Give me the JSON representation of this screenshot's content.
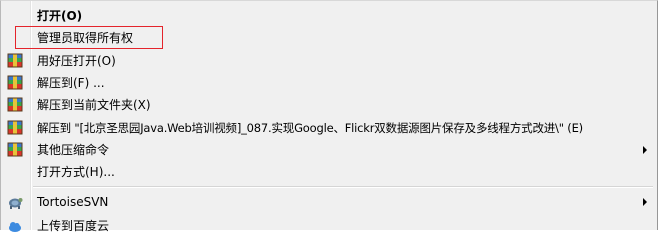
{
  "context_menu": {
    "items": [
      {
        "label": "打开(O)",
        "bold": true,
        "icon": "",
        "submenu": false
      },
      {
        "label": "管理员取得所有权",
        "bold": false,
        "icon": "",
        "submenu": false
      },
      {
        "label": "用好压打开(O)",
        "bold": false,
        "icon": "haozip-archive-icon",
        "submenu": false
      },
      {
        "label": "解压到(F) ...",
        "bold": false,
        "icon": "haozip-archive-icon",
        "submenu": false
      },
      {
        "label": "解压到当前文件夹(X)",
        "bold": false,
        "icon": "haozip-archive-icon",
        "submenu": false
      },
      {
        "label": "解压到 \"[北京圣思园Java.Web培训视频]_087.实现Google、Flickr双数据源图片保存及多线程方式改进\\\" (E)",
        "bold": false,
        "icon": "haozip-archive-icon",
        "submenu": false
      },
      {
        "label": "其他压缩命令",
        "bold": false,
        "icon": "haozip-archive-icon",
        "submenu": true
      },
      {
        "label": "打开方式(H)...",
        "bold": false,
        "icon": "",
        "submenu": false
      },
      {
        "label": "TortoiseSVN",
        "bold": false,
        "icon": "tortoisesvn-icon",
        "submenu": true
      },
      {
        "label": "上传到百度云",
        "bold": false,
        "icon": "",
        "submenu": false
      }
    ],
    "highlight_color": "#e4242b"
  }
}
